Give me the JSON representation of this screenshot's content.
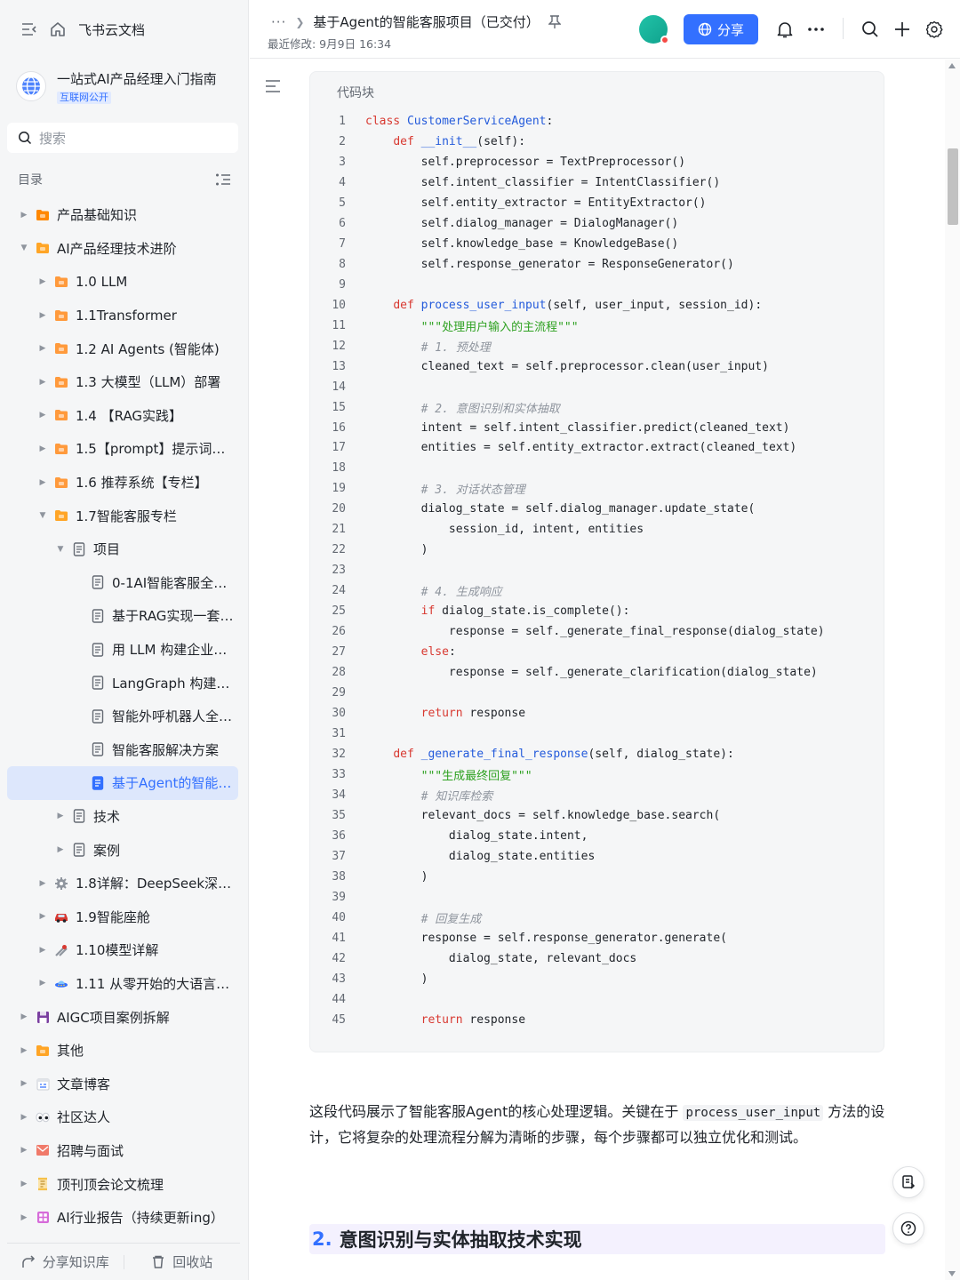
{
  "app": {
    "title": "飞书云文档"
  },
  "knowledge_base": {
    "title": "一站式AI产品经理入门指南",
    "badge": "互联网公开"
  },
  "search": {
    "placeholder": "搜索"
  },
  "toc": {
    "heading": "目录"
  },
  "tree": [
    {
      "label": "产品基础知识",
      "level": 0,
      "state": "collapsed",
      "icon": "folder-icon",
      "icon_color": "#ff8800"
    },
    {
      "label": "AI产品经理技术进阶",
      "level": 0,
      "state": "expanded",
      "icon": "folder-icon",
      "icon_color": "#ffa526"
    },
    {
      "label": "1.0 LLM",
      "level": 1,
      "state": "collapsed",
      "icon": "folder-icon",
      "icon_color": "#ff9a3c"
    },
    {
      "label": "1.1Transformer",
      "level": 1,
      "state": "collapsed",
      "icon": "folder-icon",
      "icon_color": "#ff9a3c"
    },
    {
      "label": "1.2 AI Agents (智能体)",
      "level": 1,
      "state": "collapsed",
      "icon": "folder-icon",
      "icon_color": "#ff9a3c"
    },
    {
      "label": "1.3 大模型（LLM）部署",
      "level": 1,
      "state": "collapsed",
      "icon": "folder-icon",
      "icon_color": "#ff9a3c"
    },
    {
      "label": "1.4 【RAG实践】",
      "level": 1,
      "state": "collapsed",
      "icon": "folder-icon",
      "icon_color": "#ff9a3c"
    },
    {
      "label": "1.5【prompt】提示词工程",
      "level": 1,
      "state": "collapsed",
      "icon": "folder-icon",
      "icon_color": "#ff9a3c"
    },
    {
      "label": "1.6 推荐系统【专栏】",
      "level": 1,
      "state": "collapsed",
      "icon": "folder-icon",
      "icon_color": "#ff9a3c"
    },
    {
      "label": "1.7智能客服专栏",
      "level": 1,
      "state": "expanded",
      "icon": "folder-icon",
      "icon_color": "#ffa526"
    },
    {
      "label": "项目",
      "level": 2,
      "state": "expanded",
      "icon": "doc-icon",
      "icon_color": "#646a73"
    },
    {
      "label": "0-1AI智能客服全落...",
      "level": 3,
      "state": "leaf",
      "icon": "doc-icon",
      "icon_color": "#646a73"
    },
    {
      "label": "基于RAG实现一套企...",
      "level": 3,
      "state": "leaf",
      "icon": "doc-icon",
      "icon_color": "#646a73"
    },
    {
      "label": "用 LLM 构建企业专...",
      "level": 3,
      "state": "leaf",
      "icon": "doc-icon",
      "icon_color": "#646a73"
    },
    {
      "label": "LangGraph 构建AI...",
      "level": 3,
      "state": "leaf",
      "icon": "doc-icon",
      "icon_color": "#646a73"
    },
    {
      "label": "智能外呼机器人全链...",
      "level": 3,
      "state": "leaf",
      "icon": "doc-icon",
      "icon_color": "#646a73"
    },
    {
      "label": "智能客服解决方案",
      "level": 3,
      "state": "leaf",
      "icon": "doc-icon",
      "icon_color": "#646a73"
    },
    {
      "label": "基于Agent的智能客...",
      "level": 3,
      "state": "leaf",
      "icon": "doc-icon",
      "icon_color": "#3370ff",
      "active": true
    },
    {
      "label": "技术",
      "level": 2,
      "state": "collapsed",
      "icon": "doc-icon",
      "icon_color": "#646a73"
    },
    {
      "label": "案例",
      "level": 2,
      "state": "collapsed",
      "icon": "doc-icon",
      "icon_color": "#646a73"
    },
    {
      "label": "1.8详解：DeepSeek深度推...",
      "level": 1,
      "state": "collapsed",
      "icon": "gear-icon",
      "icon_color": "#8f959e"
    },
    {
      "label": "1.9智能座舱",
      "level": 1,
      "state": "collapsed",
      "icon": "car-icon",
      "icon_color": "#d83931"
    },
    {
      "label": "1.10模型详解",
      "level": 1,
      "state": "collapsed",
      "icon": "tools-icon",
      "icon_color": "#8f959e"
    },
    {
      "label": "1.11 从零开始的大语言模...",
      "level": 1,
      "state": "collapsed",
      "icon": "ufo-icon",
      "icon_color": "#3370ff"
    },
    {
      "label": "AIGC项目案例拆解",
      "level": 0,
      "state": "collapsed",
      "icon": "floppy-icon",
      "icon_color": "#7a3fa0"
    },
    {
      "label": "其他",
      "level": 0,
      "state": "collapsed",
      "icon": "folder-icon",
      "icon_color": "#ffa526"
    },
    {
      "label": "文章博客",
      "level": 0,
      "state": "collapsed",
      "icon": "calendar-icon",
      "icon_color": "#e0e3e8"
    },
    {
      "label": "社区达人",
      "level": 0,
      "state": "collapsed",
      "icon": "eyes-icon",
      "icon_color": "#1f2329"
    },
    {
      "label": "招聘与面试",
      "level": 0,
      "state": "collapsed",
      "icon": "mail-icon",
      "icon_color": "#f07a6a"
    },
    {
      "label": "顶刊顶会论文梳理",
      "level": 0,
      "state": "collapsed",
      "icon": "scroll-icon",
      "icon_color": "#f5c04a"
    },
    {
      "label": "AI行业报告（持续更新ing）",
      "level": 0,
      "state": "collapsed",
      "icon": "grid-icon",
      "icon_color": "#d66bd9"
    }
  ],
  "sidebar_footer": {
    "share_label": "分享知识库",
    "trash_label": "回收站"
  },
  "header": {
    "more": "···",
    "breadcrumb_title": "基于Agent的智能客服项目（已交付）",
    "last_modified": "最近修改: 9月9日 16:34",
    "share_label": "分享"
  },
  "code_block": {
    "title": "代码块",
    "lines": [
      "[[kw:class]] [[fn:CustomerServiceAgent]]:",
      "    [[kw:def]] [[fn:__init__]](self):",
      "        self.preprocessor = TextPreprocessor()",
      "        self.intent_classifier = IntentClassifier()",
      "        self.entity_extractor = EntityExtractor()",
      "        self.dialog_manager = DialogManager()",
      "        self.knowledge_base = KnowledgeBase()",
      "        self.response_generator = ResponseGenerator()",
      "",
      "    [[kw:def]] [[fn:process_user_input]](self, user_input, session_id):",
      "        [[str:\"\"\"处理用户输入的主流程\"\"\"]]",
      "        [[cm:# 1. 预处理]]",
      "        cleaned_text = self.preprocessor.clean(user_input)",
      "",
      "        [[cm:# 2. 意图识别和实体抽取]]",
      "        intent = self.intent_classifier.predict(cleaned_text)",
      "        entities = self.entity_extractor.extract(cleaned_text)",
      "",
      "        [[cm:# 3. 对话状态管理]]",
      "        dialog_state = self.dialog_manager.update_state(",
      "            session_id, intent, entities",
      "        )",
      "",
      "        [[cm:# 4. 生成响应]]",
      "        [[kw:if]] dialog_state.is_complete():",
      "            response = self._generate_final_response(dialog_state)",
      "        [[kw:else]]:",
      "            response = self._generate_clarification(dialog_state)",
      "",
      "        [[kw:return]] response",
      "",
      "    [[kw:def]] [[fn:_generate_final_response]](self, dialog_state):",
      "        [[str:\"\"\"生成最终回复\"\"\"]]",
      "        [[cm:# 知识库检索]]",
      "        relevant_docs = self.knowledge_base.search(",
      "            dialog_state.intent,",
      "            dialog_state.entities",
      "        )",
      "",
      "        [[cm:# 回复生成]]",
      "        response = self.response_generator.generate(",
      "            dialog_state, relevant_docs",
      "        )",
      "",
      "        [[kw:return]] response"
    ]
  },
  "paragraph": {
    "before": "这段代码展示了智能客服Agent的核心处理逻辑。关键在于",
    "code": "process_user_input",
    "after": "方法的设计，它将复杂的处理流程分解为清晰的步骤，每个步骤都可以独立优化和测试。"
  },
  "heading2": {
    "number": "2.",
    "text": "意图识别与实体抽取技术实现"
  }
}
